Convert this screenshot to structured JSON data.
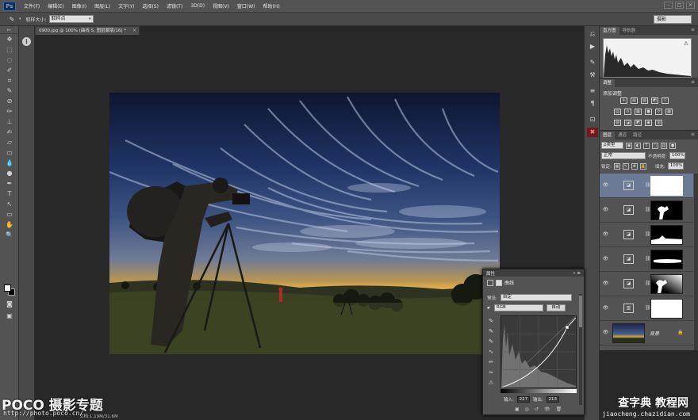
{
  "app": {
    "logo": "Ps",
    "menu": [
      "文件(F)",
      "编辑(E)",
      "图像(I)",
      "图层(L)",
      "文字(Y)",
      "选择(S)",
      "滤镜(T)",
      "3D(D)",
      "视图(V)",
      "窗口(W)",
      "帮助(H)"
    ],
    "window_controls": [
      "–",
      "□",
      "×"
    ]
  },
  "options": {
    "tool_icon": "eyedropper-icon",
    "sample_size_label": "取样大小:",
    "sample_size_value": "取样点",
    "workspace": "摄影"
  },
  "document": {
    "tab_title": "0900.jpg @ 100% (曲线 5, 图层蒙版/16) *",
    "close": "×",
    "status": "文档:1.19M/31.6M"
  },
  "histogram_panel": {
    "tabs": [
      "直方图",
      "导航器"
    ],
    "warning": "⚠"
  },
  "adjustments_panel": {
    "tab": "调整",
    "title": "添加调整",
    "row1": [
      "☀",
      "▥",
      "▨",
      "◩",
      "▽"
    ],
    "row2": [
      "▤",
      "♎",
      "▦",
      "●",
      "⟳",
      "▦"
    ],
    "row3": [
      "▨",
      "◪",
      "◩",
      "▣",
      "▥"
    ]
  },
  "layers_panel": {
    "tabs": [
      "图层",
      "通道",
      "路径"
    ],
    "filter": "ρ类型",
    "blend_mode": "正常",
    "opacity_label": "不透明度:",
    "opacity_value": "100%",
    "lock_label": "锁定:",
    "fill_label": "填充:",
    "fill_value": "100%",
    "background_name": "背景",
    "background_lock": "🔒"
  },
  "properties_panel": {
    "header": "属性",
    "header_ctrls": "» ≡",
    "title": "曲线",
    "preset_label": "预设:",
    "preset_value": "自定",
    "channel_value": "RGB",
    "auto_button": "自动",
    "input_label": "输入:",
    "input_value": "227",
    "output_label": "输出:",
    "output_value": "213",
    "footer_icons": [
      "▣",
      "◎",
      "↺",
      "👁",
      "🗑"
    ]
  },
  "watermarks": {
    "left_brand": "POCO 摄影专题",
    "left_url": "http://photo.poco.cn/",
    "right_brand": "查字典 教程网",
    "right_url": "jiaocheng.chazidian.com"
  },
  "colors": {
    "ui_dark": "#282828",
    "panel": "#535353",
    "selected_layer": "#6b7b96"
  }
}
